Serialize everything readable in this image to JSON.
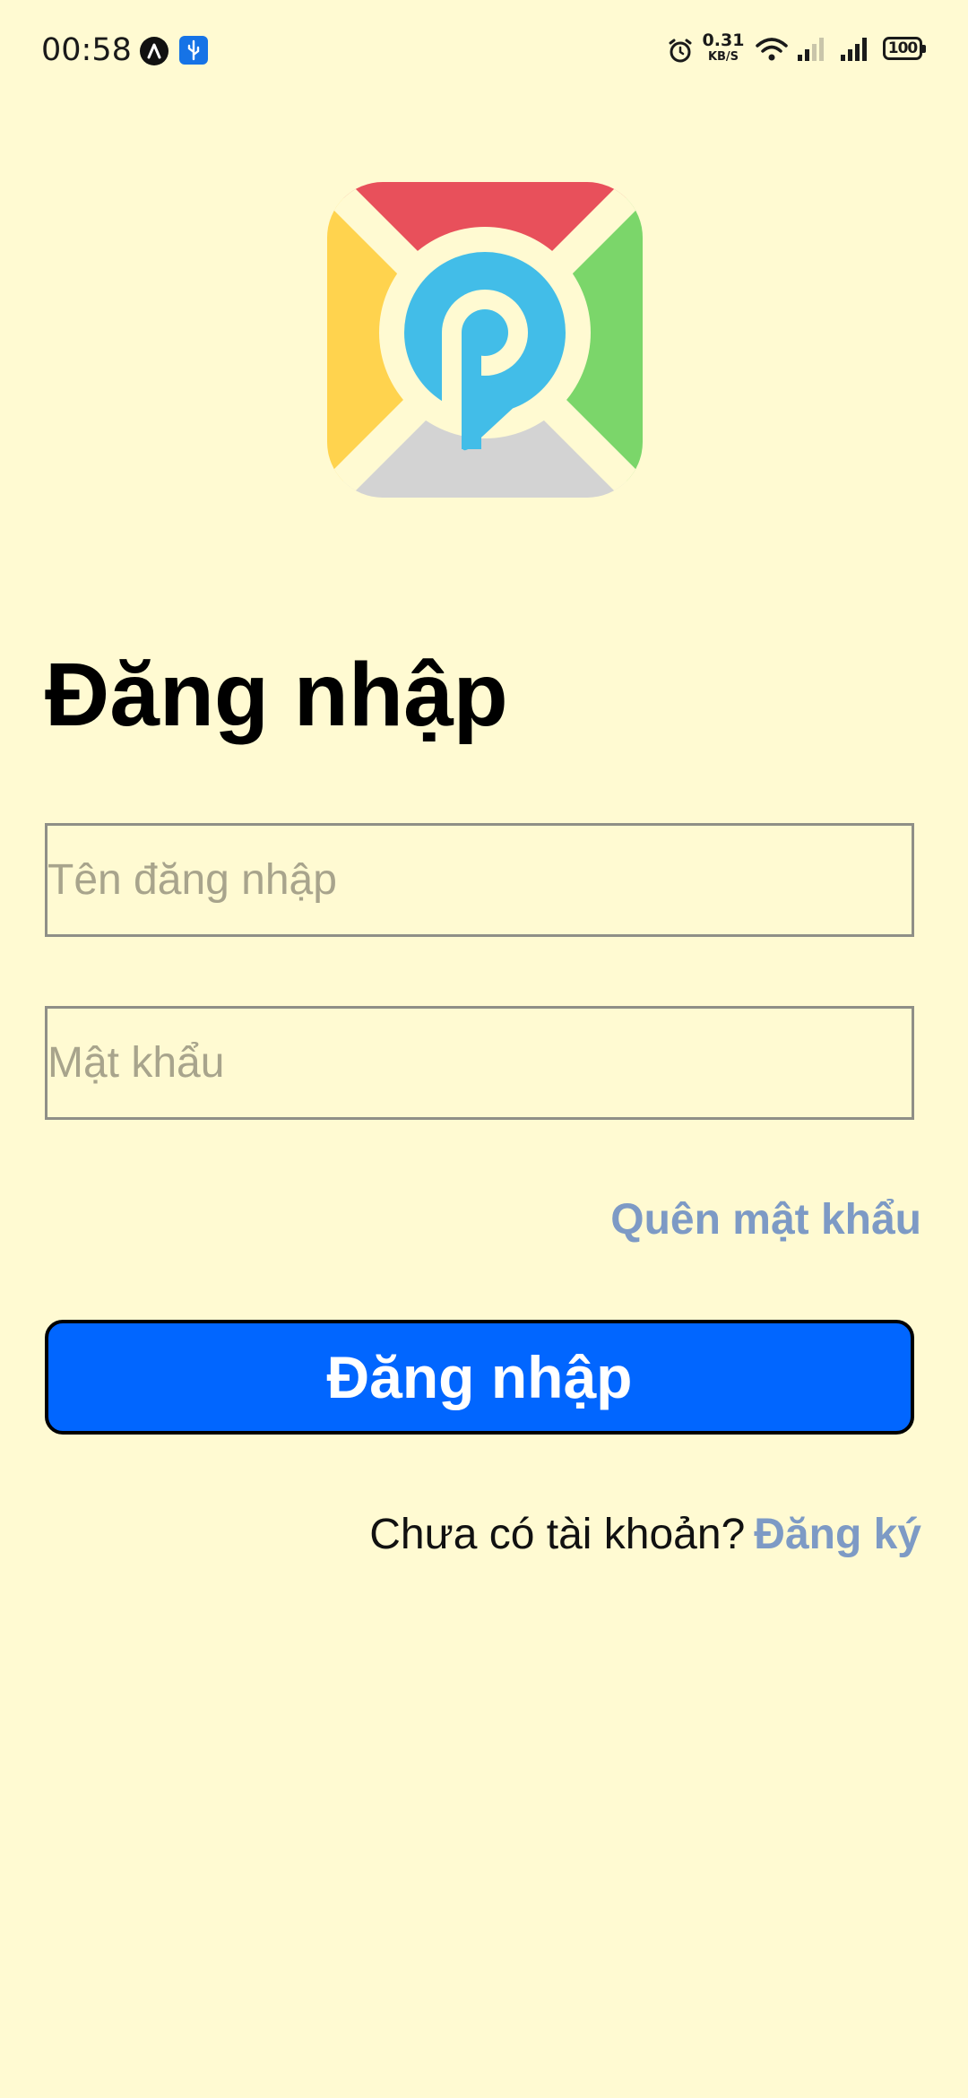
{
  "status_bar": {
    "time": "00:58",
    "net_speed_value": "0.31",
    "net_speed_unit": "KB/S",
    "battery": "100",
    "icons": [
      "app-a-icon",
      "usb-icon",
      "alarm-icon",
      "wifi-icon",
      "signal-icon",
      "signal-icon",
      "battery-icon"
    ]
  },
  "logo": {
    "icon": "map-pin-logo-icon",
    "colors": {
      "top": "#e8505b",
      "left": "#ffd34e",
      "right": "#7bd66a",
      "bottom": "#d3d3d3",
      "pin": "#42bde8",
      "background": "#fffad2"
    }
  },
  "login": {
    "title": "Đăng nhập",
    "username_placeholder": "Tên đăng nhập",
    "password_placeholder": "Mật khẩu",
    "forgot_password": "Quên mật khẩu",
    "submit_label": "Đăng nhập",
    "signup_prompt": "Chưa có tài khoản?",
    "signup_link": "Đăng ký"
  },
  "colors": {
    "background": "#fffad2",
    "primary_button": "#0166ff",
    "link": "#7d9ac5"
  }
}
